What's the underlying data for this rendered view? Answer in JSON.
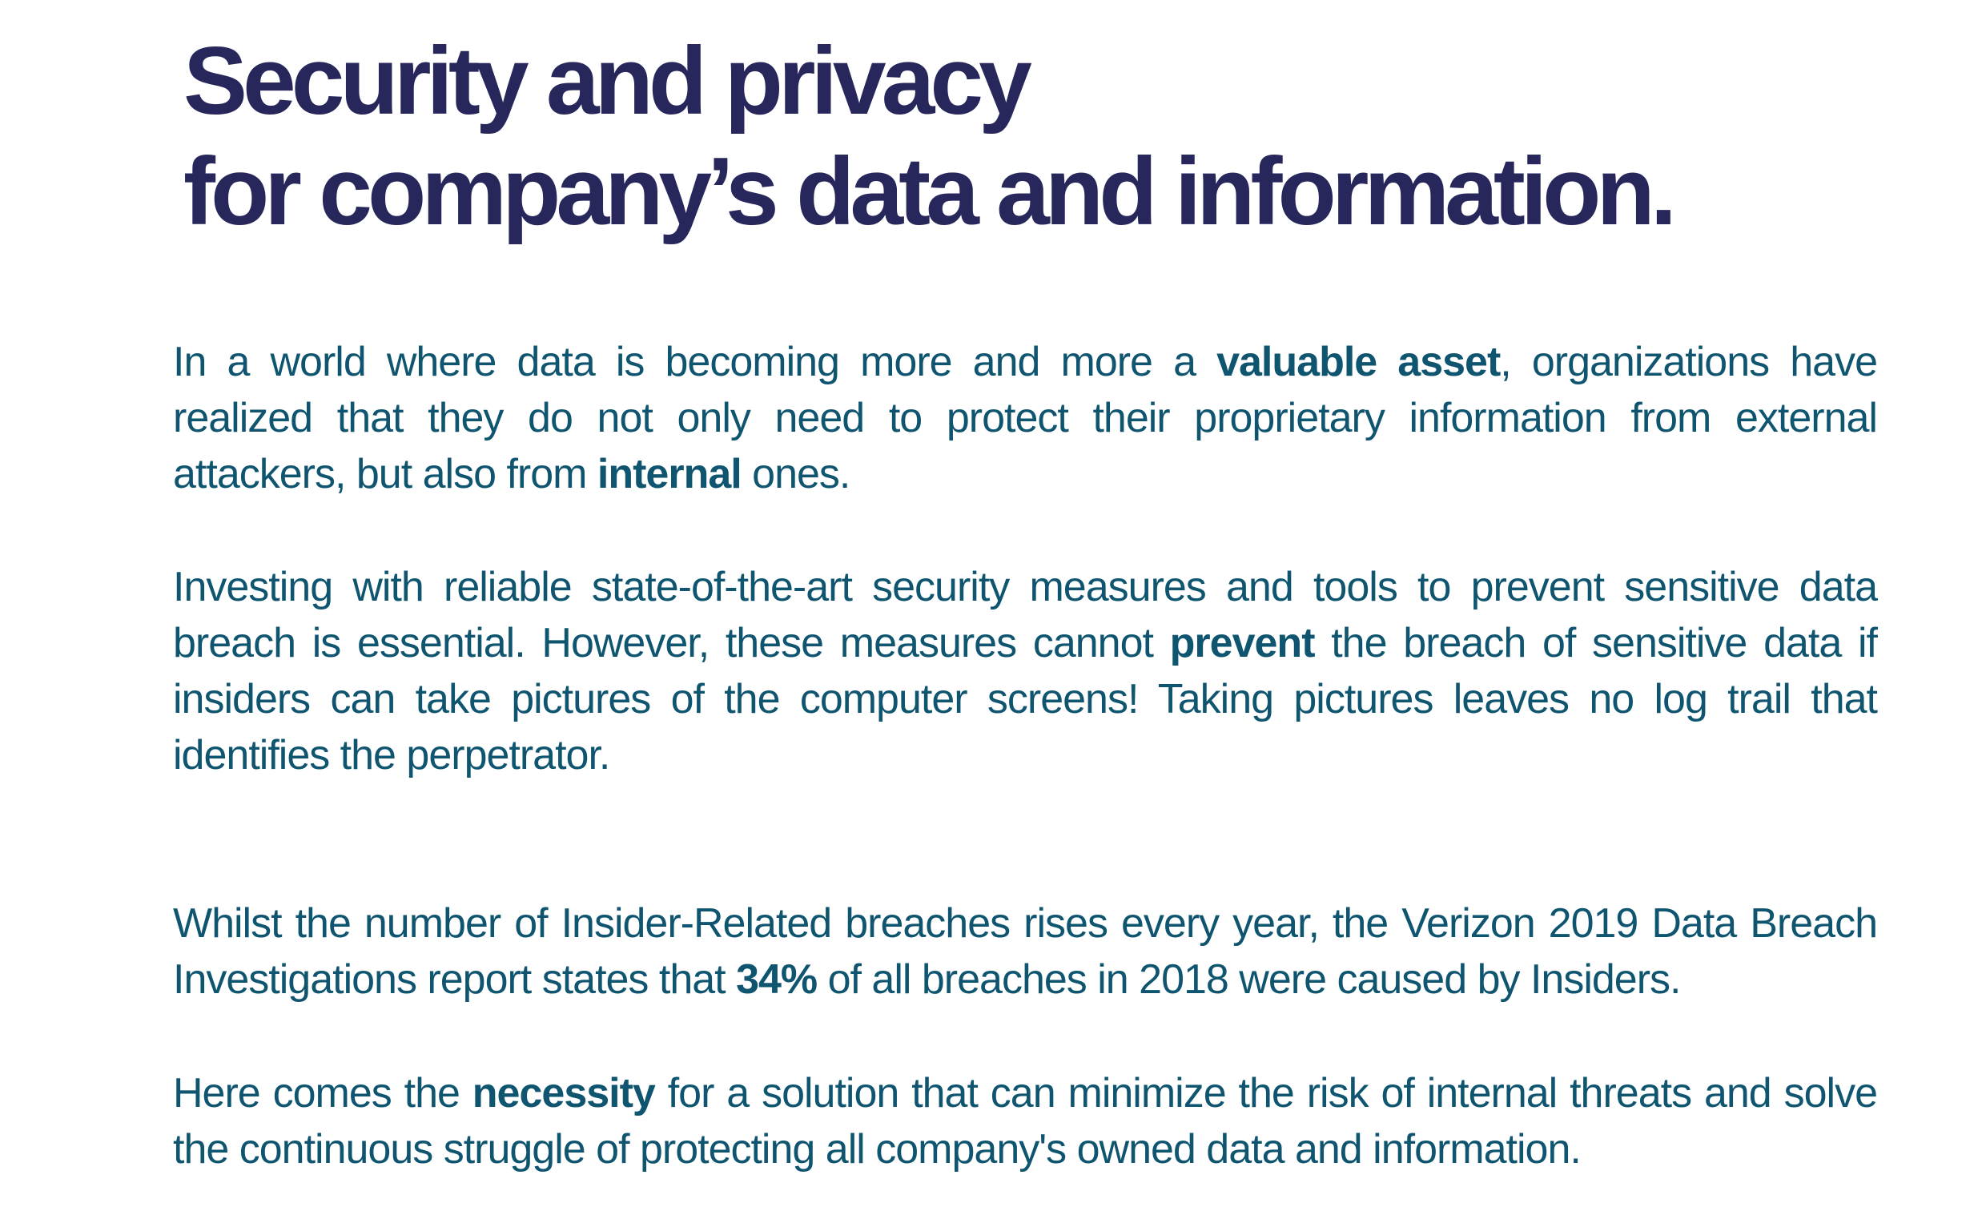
{
  "title": {
    "line1": "Security and privacy",
    "line2": "for company’s data and information."
  },
  "paragraphs": {
    "p1": {
      "a": "In a world where data is becoming more and more a ",
      "b": "valuable asset",
      "c": ", organizations have realized that they do not only need to protect their proprietary information from external attackers, but also from ",
      "d": "internal",
      "e": " ones."
    },
    "p2": {
      "a": "Investing with reliable state-of-the-art security measures and tools to prevent sensitive data breach is essential.   However, these measures cannot ",
      "b": "prevent",
      "c": " the breach of sensitive data if insiders can take pictures of the computer screens! Taking pictures leaves no log trail that identifies the perpetrator."
    },
    "p3": {
      "a": "Whilst the number of Insider-Related breaches rises every year, the Verizon 2019 Data Breach Investigations report states that ",
      "b": "34%",
      "c": " of all breaches in 2018 were caused by Insiders."
    },
    "p4": {
      "a": "Here comes the ",
      "b": "necessity",
      "c": " for a solution that can minimize the risk of internal threats and solve the continuous struggle of protecting all company's owned data and information."
    }
  },
  "colors": {
    "title": "#27275c",
    "body": "#0f5570"
  }
}
